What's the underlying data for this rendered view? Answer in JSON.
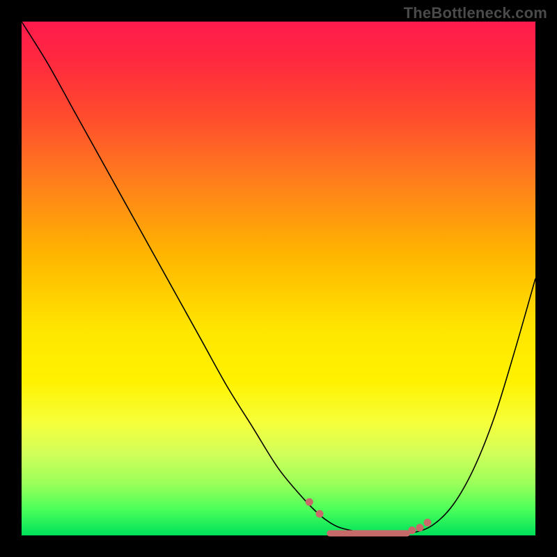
{
  "watermark": "TheBottleneck.com",
  "colors": {
    "black_frame": "#000000",
    "curve_stroke": "#000000",
    "dot_fill": "#c86a6a",
    "gradient_top": "#ff1a4d",
    "gradient_mid": "#ffe600",
    "gradient_bottom": "#00e05a"
  },
  "chart_data": {
    "type": "line",
    "title": "",
    "xlabel": "",
    "ylabel": "",
    "xlim": [
      0,
      100
    ],
    "ylim": [
      0,
      100
    ],
    "series": [
      {
        "name": "bottleneck-curve",
        "x": [
          0,
          5,
          10,
          15,
          20,
          25,
          30,
          35,
          40,
          45,
          50,
          55,
          58,
          60,
          62,
          65,
          68,
          72,
          76,
          80,
          84,
          88,
          92,
          96,
          100
        ],
        "y": [
          100,
          92,
          83,
          74,
          65,
          56,
          47,
          38,
          29,
          21,
          13,
          7,
          4,
          2.5,
          1.5,
          0.8,
          0.4,
          0.3,
          0.5,
          2,
          6,
          13,
          23,
          36,
          50
        ]
      }
    ],
    "markers": [
      {
        "x": 56,
        "y": 6.5
      },
      {
        "x": 58,
        "y": 4.2
      },
      {
        "x": 76,
        "y": 1.0
      },
      {
        "x": 77.5,
        "y": 1.5
      },
      {
        "x": 79,
        "y": 2.5
      }
    ],
    "marker_segment": {
      "x_start": 60,
      "x_end": 75,
      "y": 0.4
    }
  }
}
